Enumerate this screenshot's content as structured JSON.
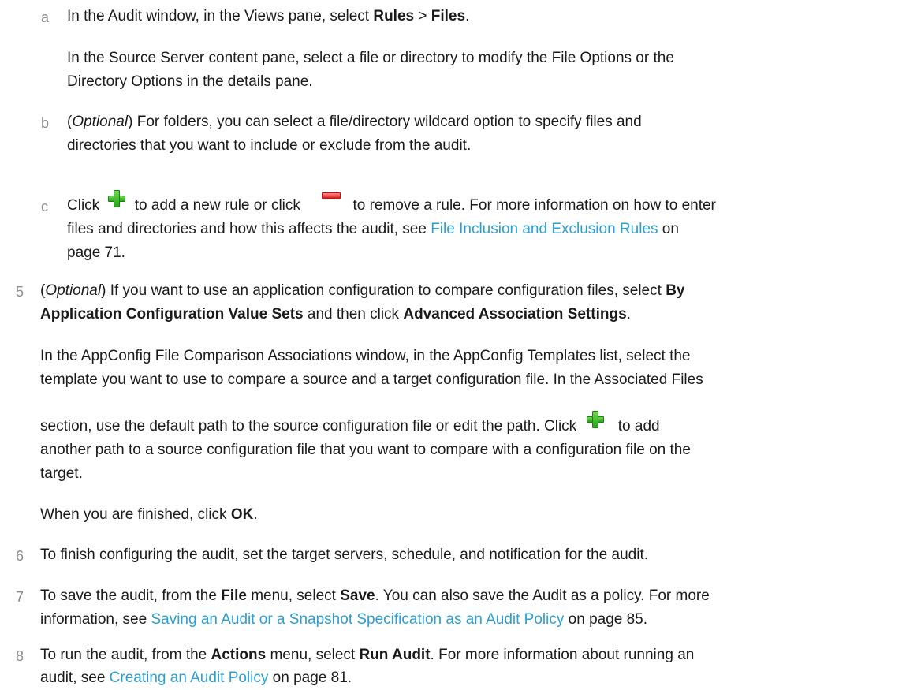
{
  "step_a": {
    "num": "a",
    "l1_pre": "In the Audit window, in the Views pane, select ",
    "l1_b1": "Rules",
    "l1_sep": " > ",
    "l1_b2": "Files",
    "l1_end": ".",
    "p2_l1": "In the Source Server content pane, select a file or directory to modify the File Options or the",
    "p2_l2": "Directory Options in the details pane."
  },
  "step_b": {
    "num": "b",
    "l1_pre": "(",
    "l1_opt": "Optional",
    "l1_post": ") For folders, you can select a file/directory wildcard option to specify files and",
    "l2": "directories that you want to include or exclude from the audit."
  },
  "step_c": {
    "num": "c",
    "t1": "Click ",
    "t2": " to add a new rule or click ",
    "t3": " to remove a rule. For more information on how to enter",
    "l2_pre": "files and directories and how this affects the audit, see ",
    "l2_link": "File Inclusion and Exclusion Rules",
    "l2_post": " on",
    "l3": "page 71."
  },
  "step_5": {
    "num": "5",
    "l1_pre": "(",
    "l1_opt": "Optional",
    "l1_post": ") If you want to use an application configuration to compare configuration files, select ",
    "l1_b": "By",
    "l2_b1": "Application Configuration Value Sets",
    "l2_mid": " and then click ",
    "l2_b2": "Advanced Association Settings",
    "l2_end": ".",
    "p2_l1": "In the AppConfig File Comparison Associations window, in the AppConfig Templates list, select the",
    "p2_l2": "template you want to use to compare a source and a target configuration file. In the Associated Files",
    "p2_l3_pre": "section, use the default path to the source configuration file or edit the path. Click ",
    "p2_l3_post": " to add",
    "p2_l4": "another path to a source configuration file that you want to compare with a configuration file on the",
    "p2_l5": "target.",
    "p3_pre": "When you are finished, click ",
    "p3_b": "OK",
    "p3_end": "."
  },
  "step_6": {
    "num": "6",
    "l1": "To finish configuring the audit, set the target servers, schedule, and notification for the audit."
  },
  "step_7": {
    "num": "7",
    "l1_pre": "To save the audit, from the ",
    "l1_b1": "File",
    "l1_mid": " menu, select ",
    "l1_b2": "Save",
    "l1_post": ". You can also save the Audit as a policy. For more",
    "l2_pre": "information, see ",
    "l2_link": "Saving an Audit or a Snapshot Specification as an Audit Policy",
    "l2_post": " on page 85."
  },
  "step_8": {
    "num": "8",
    "l1_pre": "To run the audit, from the ",
    "l1_b1": "Actions",
    "l1_mid": " menu, select ",
    "l1_b2": "Run Audit",
    "l1_post": ". For more information about running an",
    "l2_pre": "audit, see ",
    "l2_link": "Creating an Audit Policy",
    "l2_post": " on page 81."
  },
  "icons": {
    "add": "plus-icon",
    "remove": "minus-icon"
  },
  "colors": {
    "link": "#2a9fd6",
    "step_number": "#8c8c8c"
  }
}
